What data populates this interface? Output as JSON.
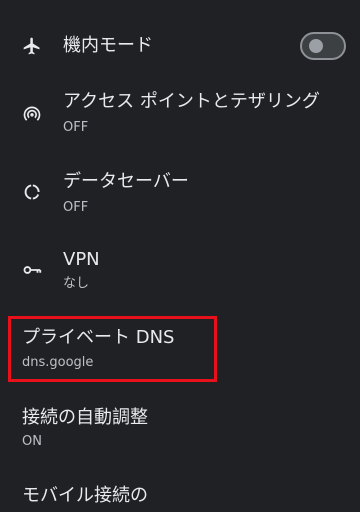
{
  "settings": {
    "airplane": {
      "title": "機内モード",
      "toggle_on": false,
      "icon": "airplane-icon"
    },
    "hotspot": {
      "title": "アクセス ポイントとテザリング",
      "subtitle": "OFF",
      "icon": "hotspot-icon"
    },
    "data_saver": {
      "title": "データセーバー",
      "subtitle": "OFF",
      "icon": "data-saver-icon"
    },
    "vpn": {
      "title": "VPN",
      "subtitle": "なし",
      "icon": "key-icon"
    },
    "private_dns": {
      "title": "プライベート DNS",
      "subtitle": "dns.google"
    },
    "adaptive": {
      "title": "接続の自動調整",
      "subtitle": "ON"
    },
    "mobile": {
      "title": "モバイル接続の"
    }
  },
  "colors": {
    "background": "#202124",
    "highlight": "#e8101a"
  }
}
